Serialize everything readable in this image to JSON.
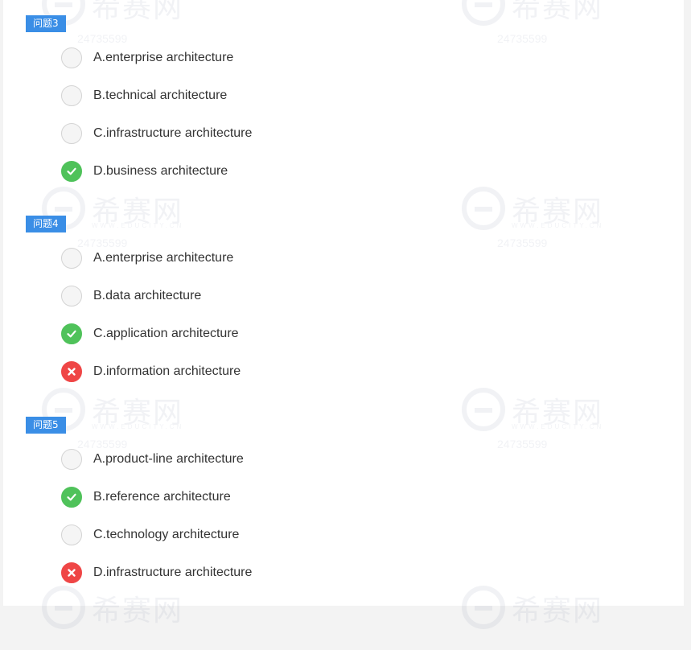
{
  "colors": {
    "label_bg": "#3a8ee6",
    "correct": "#4fc25a",
    "wrong": "#ef4646",
    "neutral": "#f5f5f5"
  },
  "watermark": {
    "brand": "希赛网",
    "site": "WWW.EDUCITY.CN",
    "id": "24735599"
  },
  "questions": [
    {
      "label": "问题3",
      "options": [
        {
          "text": "A.enterprise architecture",
          "state": "none",
          "icon": "empty-circle"
        },
        {
          "text": "B.technical architecture",
          "state": "none",
          "icon": "empty-circle"
        },
        {
          "text": "C.infrastructure architecture",
          "state": "none",
          "icon": "empty-circle"
        },
        {
          "text": "D.business architecture",
          "state": "correct",
          "icon": "check-icon"
        }
      ]
    },
    {
      "label": "问题4",
      "options": [
        {
          "text": "A.enterprise architecture",
          "state": "none",
          "icon": "empty-circle"
        },
        {
          "text": "B.data architecture",
          "state": "none",
          "icon": "empty-circle"
        },
        {
          "text": "C.application architecture",
          "state": "correct",
          "icon": "check-icon"
        },
        {
          "text": "D.information architecture",
          "state": "wrong",
          "icon": "cross-icon"
        }
      ]
    },
    {
      "label": "问题5",
      "options": [
        {
          "text": "A.product-line architecture",
          "state": "none",
          "icon": "empty-circle"
        },
        {
          "text": "B.reference architecture",
          "state": "correct",
          "icon": "check-icon"
        },
        {
          "text": "C.technology architecture",
          "state": "none",
          "icon": "empty-circle"
        },
        {
          "text": "D.infrastructure architecture",
          "state": "wrong",
          "icon": "cross-icon"
        }
      ]
    }
  ]
}
